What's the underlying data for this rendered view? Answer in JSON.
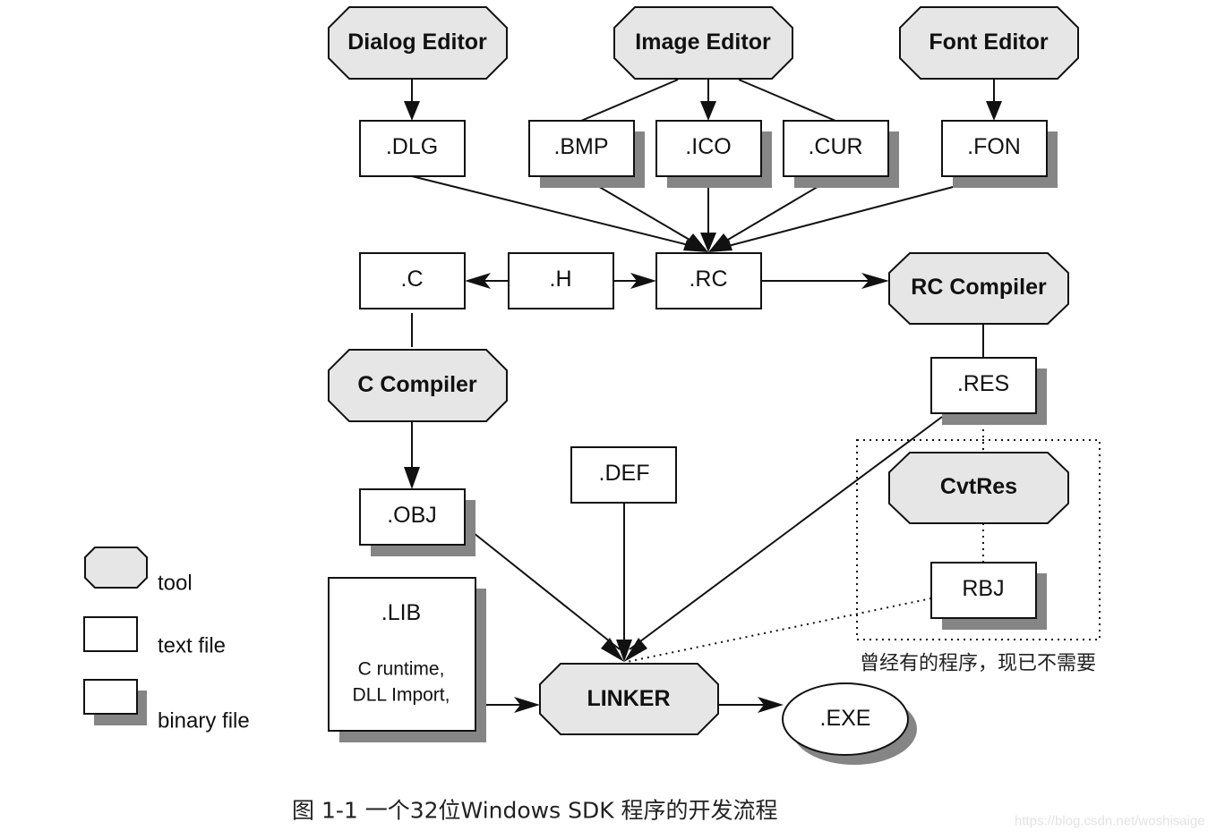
{
  "diagram": {
    "tools": {
      "dialog_editor": "Dialog Editor",
      "image_editor": "Image Editor",
      "font_editor": "Font Editor",
      "rc_compiler": "RC Compiler",
      "c_compiler": "C Compiler",
      "cvtres": "CvtRes",
      "linker": "LINKER"
    },
    "files": {
      "dlg": ".DLG",
      "bmp": ".BMP",
      "ico": ".ICO",
      "cur": ".CUR",
      "fon": ".FON",
      "c": ".C",
      "h": ".H",
      "rc": ".RC",
      "res": ".RES",
      "obj": ".OBJ",
      "def": ".DEF",
      "rbj": "RBJ",
      "lib": ".LIB",
      "lib_desc_line1": "C runtime,",
      "lib_desc_line2": "DLL Import,",
      "exe": ".EXE"
    },
    "edges": [
      {
        "from": "Dialog Editor",
        "to": ".DLG",
        "style": "arrow"
      },
      {
        "from": "Image Editor",
        "to": ".BMP",
        "style": "line"
      },
      {
        "from": "Image Editor",
        "to": ".ICO",
        "style": "arrow"
      },
      {
        "from": "Image Editor",
        "to": ".CUR",
        "style": "line"
      },
      {
        "from": "Font Editor",
        "to": ".FON",
        "style": "arrow"
      },
      {
        "from": ".DLG",
        "to": ".RC",
        "style": "arrow"
      },
      {
        "from": ".BMP",
        "to": ".RC",
        "style": "arrow"
      },
      {
        "from": ".ICO",
        "to": ".RC",
        "style": "arrow"
      },
      {
        "from": ".CUR",
        "to": ".RC",
        "style": "arrow"
      },
      {
        "from": ".FON",
        "to": ".RC",
        "style": "arrow"
      },
      {
        "from": ".H",
        "to": ".C",
        "style": "arrow"
      },
      {
        "from": ".H",
        "to": ".RC",
        "style": "arrow"
      },
      {
        "from": ".RC",
        "to": "RC Compiler",
        "style": "arrow"
      },
      {
        "from": "RC Compiler",
        "to": ".RES",
        "style": "line"
      },
      {
        "from": ".C",
        "to": "C Compiler",
        "style": "line"
      },
      {
        "from": "C Compiler",
        "to": ".OBJ",
        "style": "arrow"
      },
      {
        "from": ".OBJ",
        "to": "LINKER",
        "style": "arrow"
      },
      {
        "from": ".DEF",
        "to": "LINKER",
        "style": "arrow"
      },
      {
        "from": ".RES",
        "to": "LINKER",
        "style": "arrow"
      },
      {
        "from": ".RES",
        "to": "CvtRes",
        "style": "dotted"
      },
      {
        "from": "CvtRes",
        "to": "RBJ",
        "style": "dotted"
      },
      {
        "from": "RBJ",
        "to": "LINKER",
        "style": "dotted"
      },
      {
        "from": ".LIB",
        "to": "LINKER",
        "style": "arrow"
      },
      {
        "from": "LINKER",
        "to": ".EXE",
        "style": "arrow"
      }
    ],
    "obsolete_note": "曾经有的程序，现已不需要"
  },
  "legend": {
    "tool": "tool",
    "text_file": "text file",
    "binary_file": "binary file"
  },
  "caption": "图 1-1 一个32位Windows SDK 程序的开发流程",
  "watermark": "https://blog.csdn.net/woshisaige",
  "colors": {
    "tool_fill": "#e6e6e6",
    "shadow": "#858585",
    "stroke": "#111111"
  }
}
